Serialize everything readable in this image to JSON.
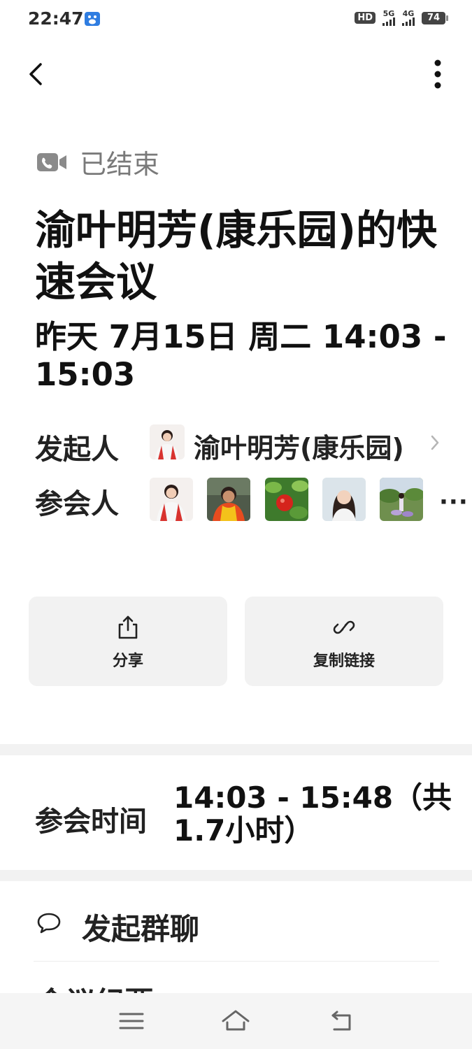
{
  "status_bar": {
    "time": "22:47",
    "hd_badge": "HD",
    "network_1": "5G",
    "network_2": "4G",
    "battery": "74",
    "app_icon": "baidu-app-icon"
  },
  "nav": {
    "back_icon": "chevron-left-icon",
    "more_icon": "more-vertical-icon"
  },
  "meeting": {
    "status_icon": "video-call-icon",
    "status": "已结束",
    "title": "渝叶明芳(康乐园)的快速会议",
    "datetime": "昨天 7月15日 周二 14:03 - 15:03",
    "initiator_label": "发起人",
    "initiator_name": "渝叶明芳(康乐园)",
    "participants_label": "参会人",
    "participants_more": "···"
  },
  "actions": {
    "share_label": "分享",
    "share_icon": "share-icon",
    "copy_link_label": "复制链接",
    "copy_link_icon": "link-icon"
  },
  "attendance": {
    "label": "参会时间",
    "value": "14:03 - 15:48（共1.7小时）"
  },
  "menu": {
    "group_chat_icon": "chat-bubble-icon",
    "group_chat_label": "发起群聊",
    "next_item_label": "会议纪要"
  },
  "system_nav": {
    "menu_icon": "menu-icon",
    "home_icon": "home-icon",
    "back_icon": "back-icon"
  },
  "colors": {
    "background": "#ffffff",
    "button_bg": "#f2f2f2",
    "divider": "#f2f2f2",
    "status_gray": "#7a7a7a"
  }
}
